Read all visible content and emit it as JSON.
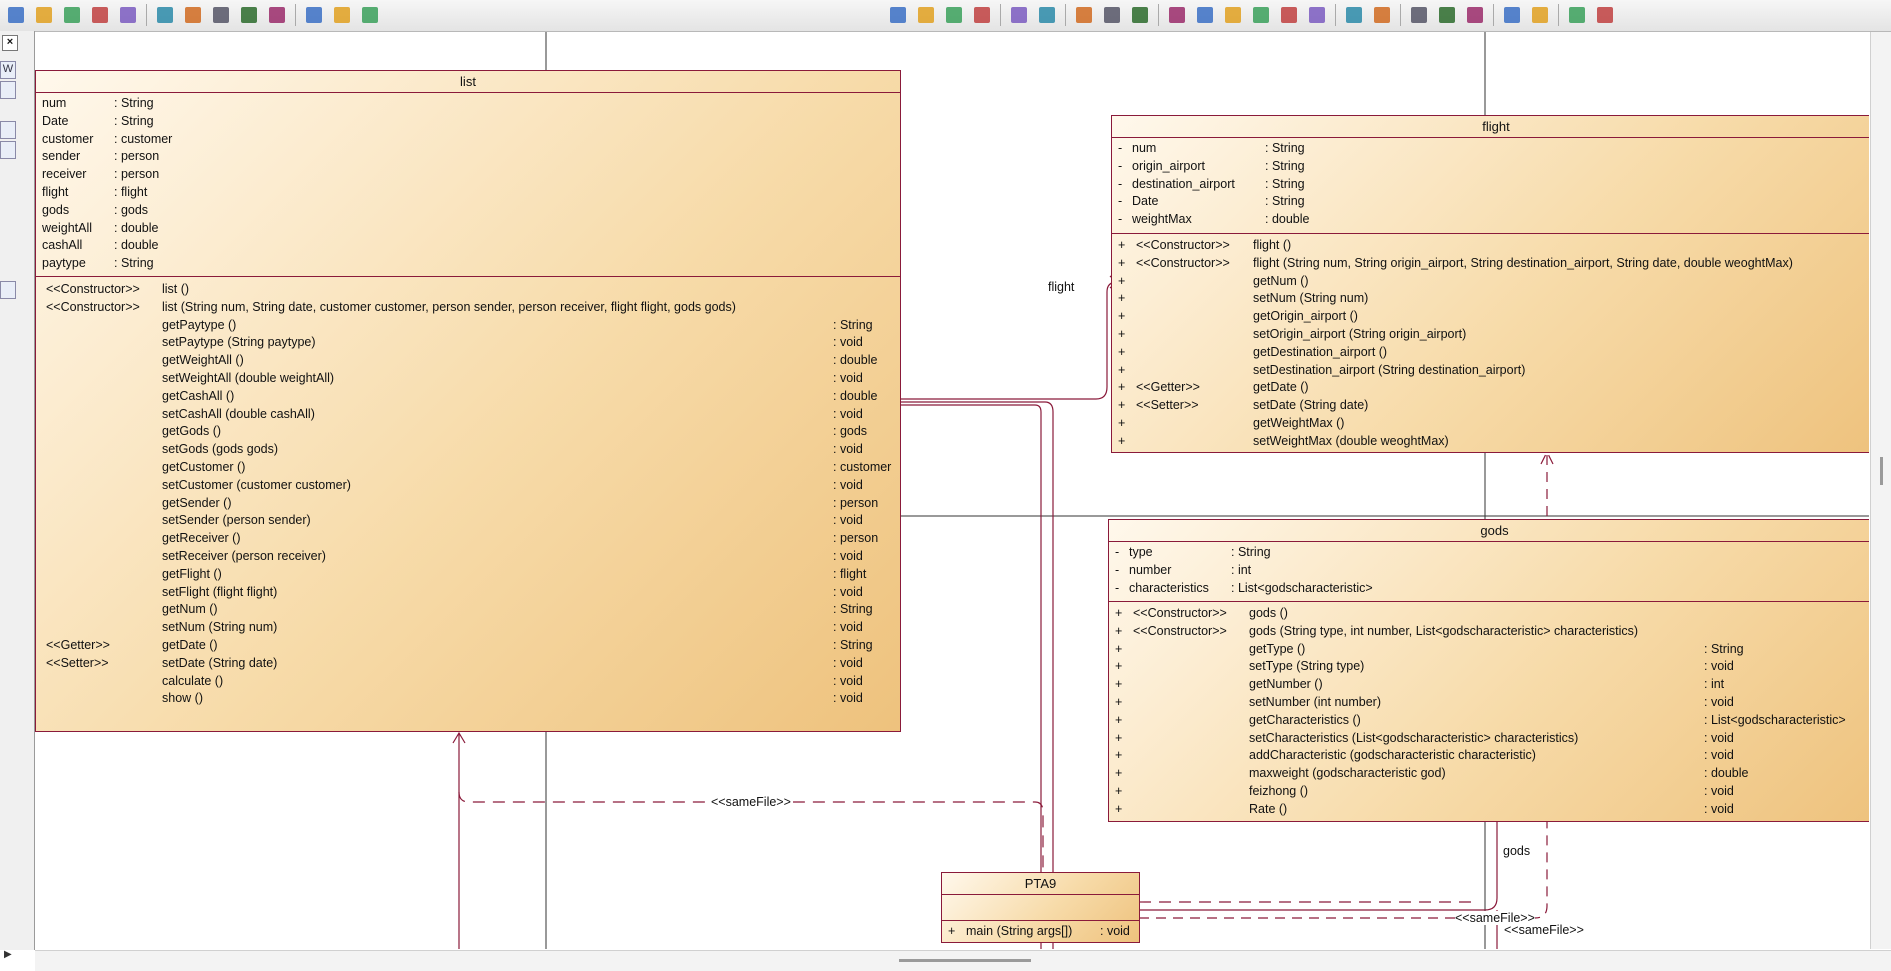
{
  "toolbar": {
    "left_icons": [
      "open-project-icon",
      "save-project-icon",
      "search-icon",
      "refresh-icon",
      "check-icon",
      "window-icon",
      "diagram-icon",
      "pencil-icon",
      "link-icon",
      "text-icon",
      "export-icon",
      "undo-arrow-icon",
      "redo-arrow-icon"
    ],
    "right_icons": [
      "layout-1-icon",
      "layout-2-icon",
      "layout-3-icon",
      "layout-4-icon",
      "package-icon",
      "disabled-icon",
      "view-diagram-icon",
      "view-text-icon",
      "view-split-icon",
      "new-file-icon",
      "folder-icon",
      "open-folder-icon",
      "save-icon",
      "save-all-icon",
      "print-preview-icon",
      "print-icon",
      "cut-icon",
      "copy-icon",
      "paste-icon",
      "delete-icon",
      "undo-icon",
      "redo-icon",
      "properties-icon",
      "help-icon"
    ]
  },
  "left_panel": {
    "close_label": "×",
    "tab_label": "W"
  },
  "classes": {
    "list": {
      "name": "list",
      "attributes": [
        {
          "name": "num",
          "type": ": String"
        },
        {
          "name": "Date",
          "type": ": String"
        },
        {
          "name": "customer",
          "type": ": customer"
        },
        {
          "name": "sender",
          "type": ": person"
        },
        {
          "name": "receiver",
          "type": ": person"
        },
        {
          "name": "flight",
          "type": ": flight"
        },
        {
          "name": "gods",
          "type": ": gods"
        },
        {
          "name": "weightAll",
          "type": ": double"
        },
        {
          "name": "cashAll",
          "type": ": double"
        },
        {
          "name": "paytype",
          "type": ": String"
        }
      ],
      "methods": [
        {
          "stereo": "<<Constructor>>",
          "sig": "list ()",
          "ret": ""
        },
        {
          "stereo": "<<Constructor>>",
          "sig": "list (String num, String date, customer customer, person sender, person receiver, flight flight, gods gods)",
          "ret": ""
        },
        {
          "stereo": "",
          "sig": "getPaytype ()",
          "ret": ": String"
        },
        {
          "stereo": "",
          "sig": "setPaytype (String paytype)",
          "ret": ": void"
        },
        {
          "stereo": "",
          "sig": "getWeightAll ()",
          "ret": ": double"
        },
        {
          "stereo": "",
          "sig": "setWeightAll (double weightAll)",
          "ret": ": void"
        },
        {
          "stereo": "",
          "sig": "getCashAll ()",
          "ret": ": double"
        },
        {
          "stereo": "",
          "sig": "setCashAll (double cashAll)",
          "ret": ": void"
        },
        {
          "stereo": "",
          "sig": "getGods ()",
          "ret": ": gods"
        },
        {
          "stereo": "",
          "sig": "setGods (gods gods)",
          "ret": ": void"
        },
        {
          "stereo": "",
          "sig": "getCustomer ()",
          "ret": ": customer"
        },
        {
          "stereo": "",
          "sig": "setCustomer (customer customer)",
          "ret": ": void"
        },
        {
          "stereo": "",
          "sig": "getSender ()",
          "ret": ": person"
        },
        {
          "stereo": "",
          "sig": "setSender (person sender)",
          "ret": ": void"
        },
        {
          "stereo": "",
          "sig": "getReceiver ()",
          "ret": ": person"
        },
        {
          "stereo": "",
          "sig": "setReceiver (person receiver)",
          "ret": ": void"
        },
        {
          "stereo": "",
          "sig": "getFlight ()",
          "ret": ": flight"
        },
        {
          "stereo": "",
          "sig": "setFlight (flight flight)",
          "ret": ": void"
        },
        {
          "stereo": "",
          "sig": "getNum ()",
          "ret": ": String"
        },
        {
          "stereo": "",
          "sig": "setNum (String num)",
          "ret": ": void"
        },
        {
          "stereo": "<<Getter>>",
          "sig": "getDate ()",
          "ret": ": String"
        },
        {
          "stereo": "<<Setter>>",
          "sig": "setDate (String date)",
          "ret": ": void"
        },
        {
          "stereo": "",
          "sig": "calculate ()",
          "ret": ": void"
        },
        {
          "stereo": "",
          "sig": "show ()",
          "ret": ": void"
        }
      ]
    },
    "flight": {
      "name": "flight",
      "attributes": [
        {
          "vis": "-",
          "name": "num",
          "type": ": String"
        },
        {
          "vis": "-",
          "name": "origin_airport",
          "type": ": String"
        },
        {
          "vis": "-",
          "name": "destination_airport",
          "type": ": String"
        },
        {
          "vis": "-",
          "name": "Date",
          "type": ": String"
        },
        {
          "vis": "-",
          "name": "weightMax",
          "type": ": double"
        }
      ],
      "methods": [
        {
          "vis": "+",
          "stereo": "<<Constructor>>",
          "sig": "flight ()",
          "ret": ""
        },
        {
          "vis": "+",
          "stereo": "<<Constructor>>",
          "sig": "flight (String num, String origin_airport, String destination_airport, String date, double weoghtMax)",
          "ret": ""
        },
        {
          "vis": "+",
          "stereo": "",
          "sig": "getNum ()",
          "ret": ""
        },
        {
          "vis": "+",
          "stereo": "",
          "sig": "setNum (String num)",
          "ret": ""
        },
        {
          "vis": "+",
          "stereo": "",
          "sig": "getOrigin_airport ()",
          "ret": ""
        },
        {
          "vis": "+",
          "stereo": "",
          "sig": "setOrigin_airport (String origin_airport)",
          "ret": ""
        },
        {
          "vis": "+",
          "stereo": "",
          "sig": "getDestination_airport ()",
          "ret": ""
        },
        {
          "vis": "+",
          "stereo": "",
          "sig": "setDestination_airport (String destination_airport)",
          "ret": ""
        },
        {
          "vis": "+",
          "stereo": "<<Getter>>",
          "sig": "getDate ()",
          "ret": ""
        },
        {
          "vis": "+",
          "stereo": "<<Setter>>",
          "sig": "setDate (String date)",
          "ret": ""
        },
        {
          "vis": "+",
          "stereo": "",
          "sig": "getWeightMax ()",
          "ret": ""
        },
        {
          "vis": "+",
          "stereo": "",
          "sig": "setWeightMax (double weoghtMax)",
          "ret": ""
        }
      ]
    },
    "gods": {
      "name": "gods",
      "attributes": [
        {
          "vis": "-",
          "name": "type",
          "type": ": String"
        },
        {
          "vis": "-",
          "name": "number",
          "type": ": int"
        },
        {
          "vis": "-",
          "name": "characteristics",
          "type": ": List<godscharacteristic>"
        }
      ],
      "methods": [
        {
          "vis": "+",
          "stereo": "<<Constructor>>",
          "sig": "gods ()",
          "ret": ""
        },
        {
          "vis": "+",
          "stereo": "<<Constructor>>",
          "sig": "gods (String type, int number, List<godscharacteristic> characteristics)",
          "ret": ""
        },
        {
          "vis": "+",
          "stereo": "",
          "sig": "getType ()",
          "ret": ": String"
        },
        {
          "vis": "+",
          "stereo": "",
          "sig": "setType (String type)",
          "ret": ": void"
        },
        {
          "vis": "+",
          "stereo": "",
          "sig": "getNumber ()",
          "ret": ": int"
        },
        {
          "vis": "+",
          "stereo": "",
          "sig": "setNumber (int number)",
          "ret": ": void"
        },
        {
          "vis": "+",
          "stereo": "",
          "sig": "getCharacteristics ()",
          "ret": ": List<godscharacteristic>"
        },
        {
          "vis": "+",
          "stereo": "",
          "sig": "setCharacteristics (List<godscharacteristic> characteristics)",
          "ret": ": void"
        },
        {
          "vis": "+",
          "stereo": "",
          "sig": "addCharacteristic (godscharacteristic characteristic)",
          "ret": ": void"
        },
        {
          "vis": "+",
          "stereo": "",
          "sig": "maxweight (godscharacteristic god)",
          "ret": ": double"
        },
        {
          "vis": "+",
          "stereo": "",
          "sig": "feizhong ()",
          "ret": ": void"
        },
        {
          "vis": "+",
          "stereo": "",
          "sig": "Rate ()",
          "ret": ": void"
        }
      ]
    },
    "pta9": {
      "name": "PTA9",
      "methods": [
        {
          "vis": "+",
          "sig": "main (String args[])",
          "ret": ": void"
        }
      ]
    }
  },
  "edge_labels": {
    "flight_role": "flight",
    "gods_role": "gods",
    "same_file_1": "<<sameFile>>",
    "same_file_2": "<<sameFile>>",
    "same_file_3": "<<sameFile>>"
  },
  "colors": {
    "border": "#8a1a3a",
    "class_fill_light": "#fff8ec",
    "class_fill_dark": "#eec27d",
    "edge": "#8a1a3a"
  }
}
